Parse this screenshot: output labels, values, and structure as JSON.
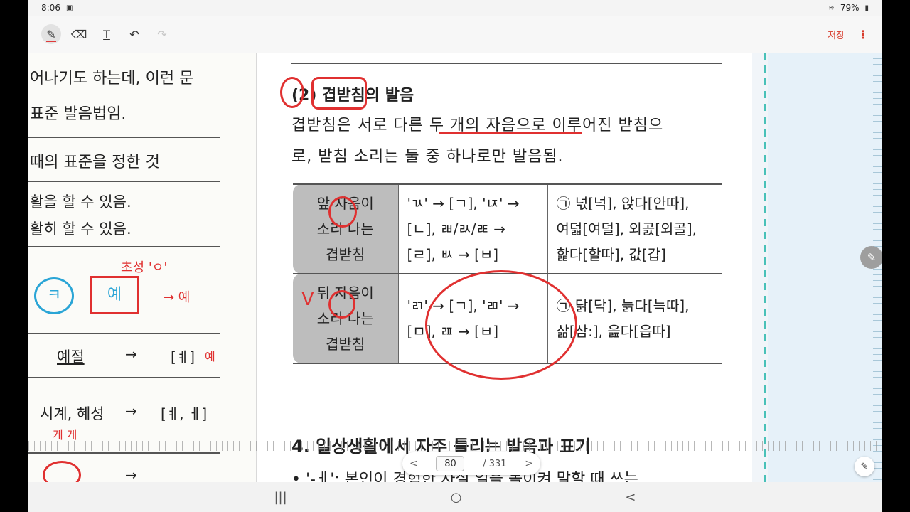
{
  "status": {
    "time": "8:06",
    "battery": "79%"
  },
  "toolbar": {
    "tools": [
      {
        "name": "pen-tool",
        "glyph": "✎"
      },
      {
        "name": "eraser-tool",
        "glyph": "⌫"
      },
      {
        "name": "text-tool",
        "glyph": "T"
      },
      {
        "name": "undo-tool",
        "glyph": "↶"
      },
      {
        "name": "redo-tool",
        "glyph": "↷"
      }
    ],
    "save_label": "저장",
    "more_glyph": "⋮"
  },
  "left_col": {
    "line1": "어나기도 하는데, 이런 문",
    "line2": "표준 발음법임.",
    "line3": "때의 표준을 정한 것",
    "line4": "활을 할 수 있음.",
    "line5": "활히 할 수 있음.",
    "circle1": "ㅋ",
    "circle2": "예",
    "row1_word": "예절",
    "row1_arrow": "→",
    "row1_result": "[ㅖ]",
    "row2_word": "시계, 혜성",
    "row2_arrow": "→",
    "row2_result": "[ㅖ, ㅔ]",
    "row3_arrow": "→"
  },
  "handwriting": {
    "note1": "초성 'ㅇ'",
    "note2": "→ 예",
    "note3": "게 게",
    "note4": "예",
    "check": "V"
  },
  "main": {
    "heading": "(2) 겹받침의 발음",
    "para_line1": "겹받침은 서로 다른 두 개의 자음으로 이루어진 받침으",
    "para_line2": "로, 받침 소리는 둘 중 하나로만 발음됨.",
    "table": [
      {
        "head": [
          "앞 자음이",
          "소리 나는",
          "겹받침"
        ],
        "rule": [
          "'ㄳ' → [ㄱ], 'ㄵ' →",
          "[ㄴ], ㄼ/ㄽ/ㄾ →",
          "[ㄹ], ㅄ → [ㅂ]"
        ],
        "example": [
          "㉠ 넋[넉], 앉다[안따],",
          "여덟[여덜], 외곬[외골],",
          "핥다[할따], 값[갑]"
        ]
      },
      {
        "head": [
          "뒤 자음이",
          "소리 나는",
          "겹받침"
        ],
        "rule": [
          "'ㄺ' → [ㄱ], 'ㄻ' →",
          "[ㅁ], ㄿ → [ㅂ]"
        ],
        "example": [
          "㉠ 닭[닥], 늙다[늑따],",
          "삶[삼:], 읊다[읍따]"
        ]
      }
    ],
    "section4": "4. 일상생활에서 자주 틀리는 발음과 표기",
    "next_line": "• '-ㅔ': 본인이 경험한 사실 일을 돌이켜 말할 때 쓰는"
  },
  "page_nav": {
    "current": "80",
    "total": "/ 331",
    "prev": "<",
    "next": ">"
  },
  "nav": {
    "recent": "|||",
    "home": "○",
    "back": "<"
  },
  "colors": {
    "accent": "#d83b2b",
    "annotation": "#e03030",
    "highlight": "#49c1b8"
  }
}
